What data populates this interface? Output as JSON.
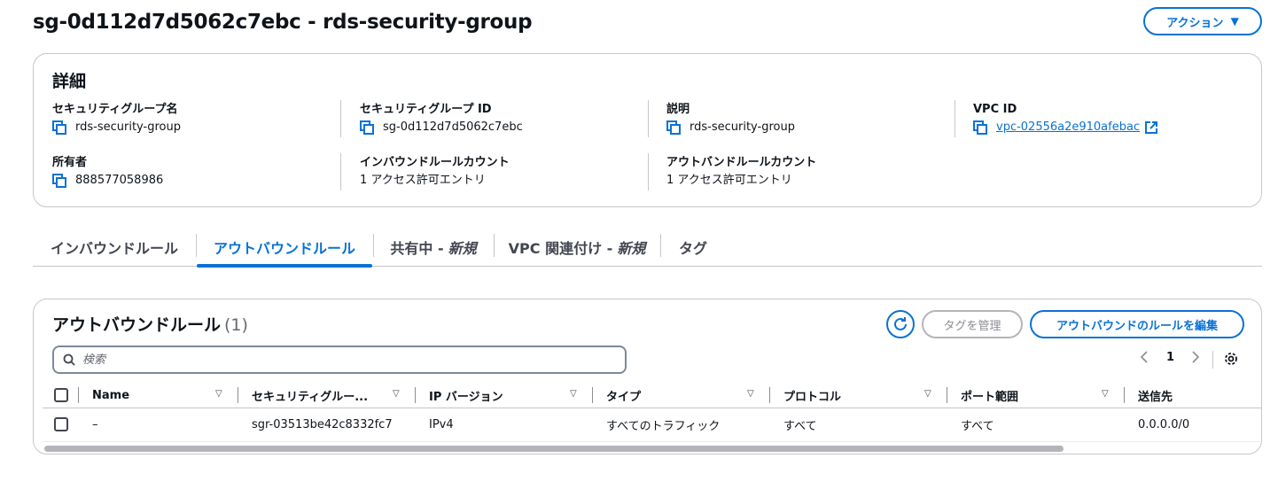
{
  "header": {
    "title": "sg-0d112d7d5062c7ebc - rds-security-group",
    "actions_label": "アクション"
  },
  "details": {
    "heading": "詳細",
    "fields": [
      {
        "label": "セキュリティグループ名",
        "value": "rds-security-group"
      },
      {
        "label": "セキュリティグループ ID",
        "value": "sg-0d112d7d5062c7ebc"
      },
      {
        "label": "説明",
        "value": "rds-security-group"
      },
      {
        "label": "VPC ID",
        "value": "vpc-02556a2e910afebac"
      },
      {
        "label": "所有者",
        "value": "888577058986"
      },
      {
        "label": "インバウンドルールカウント",
        "value": "1 アクセス許可エントリ"
      },
      {
        "label": "アウトバンドルールカウント",
        "value": "1 アクセス許可エントリ"
      }
    ]
  },
  "tabs": [
    {
      "label": "インバウンドルール",
      "suffix": ""
    },
    {
      "label": "アウトバウンドルール",
      "suffix": ""
    },
    {
      "label": "共有中 -",
      "suffix": "新規"
    },
    {
      "label": "VPC 関連付け -",
      "suffix": "新規"
    },
    {
      "label": "タグ",
      "suffix": ""
    }
  ],
  "active_tab": "アウトバウンドルール",
  "rules_table": {
    "heading": "アウトバウンドルール",
    "count": "(1)",
    "manage_tags_label": "タグを管理",
    "edit_label": "アウトバウンドのルールを編集",
    "search_placeholder": "検索",
    "current_page": "1",
    "columns": [
      "Name",
      "セキュリティグルー...",
      "IP バージョン",
      "タイプ",
      "プロトコル",
      "ポート範囲",
      "送信先"
    ],
    "rows": [
      {
        "name": "–",
        "rule_id": "sgr-03513be42c8332fc7",
        "ip_version": "IPv4",
        "type": "すべてのトラフィック",
        "protocol": "すべて",
        "port_range": "すべて",
        "destination": "0.0.0.0/0"
      }
    ]
  },
  "colors": {
    "accent": "#0972d3",
    "border": "#c6c6cd",
    "text": "#0f141a",
    "disabled": "#8c8c94"
  }
}
